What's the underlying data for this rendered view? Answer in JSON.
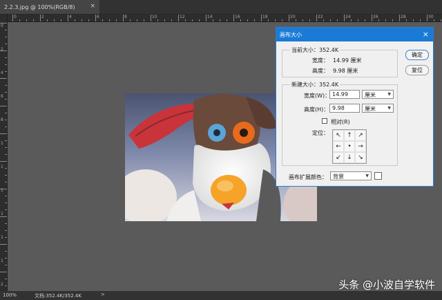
{
  "tab": {
    "title": "2.2.3.jpg @ 100%(RGB/8)",
    "close": "×"
  },
  "ruler": {
    "top_labels": [
      "0",
      "2",
      "4",
      "6",
      "8",
      "10",
      "12",
      "14",
      "16",
      "18",
      "20",
      "22",
      "24",
      "26",
      "28",
      "30",
      "32"
    ],
    "left_labels": [
      "0",
      "2",
      "4",
      "6",
      "8",
      "1",
      "1",
      "1",
      "1",
      "1",
      "1",
      "2"
    ]
  },
  "dialog": {
    "title": "画布大小",
    "close": "×",
    "current_size": {
      "label": "当前大小：352.4K",
      "width_label": "宽度：",
      "width_value": "14.99 厘米",
      "height_label": "高度：",
      "height_value": "9.98 厘米"
    },
    "new_size": {
      "label": "新建大小：352.4K",
      "width_label": "宽度(W)：",
      "width_value": "14.99",
      "width_unit": "厘米",
      "height_label": "高度(H)：",
      "height_value": "9.98",
      "height_unit": "厘米",
      "relative_label": "相对(R)",
      "relative_checked": false,
      "anchor_label": "定位："
    },
    "anchor_arrows": [
      "↖",
      "↑",
      "↗",
      "←",
      "•",
      "→",
      "↙",
      "↓",
      "↘"
    ],
    "extension_color": {
      "label": "画布扩展颜色：",
      "value": "背景",
      "swatch_color": "#ffffff"
    },
    "ok_label": "确定",
    "reset_label": "复位"
  },
  "status": {
    "zoom": "100%",
    "doc_info": "文档:352.4K/352.4K",
    "arrow": ">"
  },
  "watermark": "头条 @小波自学软件",
  "colors": {
    "title_bar": "#1a7bd6",
    "workspace": "#535353"
  }
}
